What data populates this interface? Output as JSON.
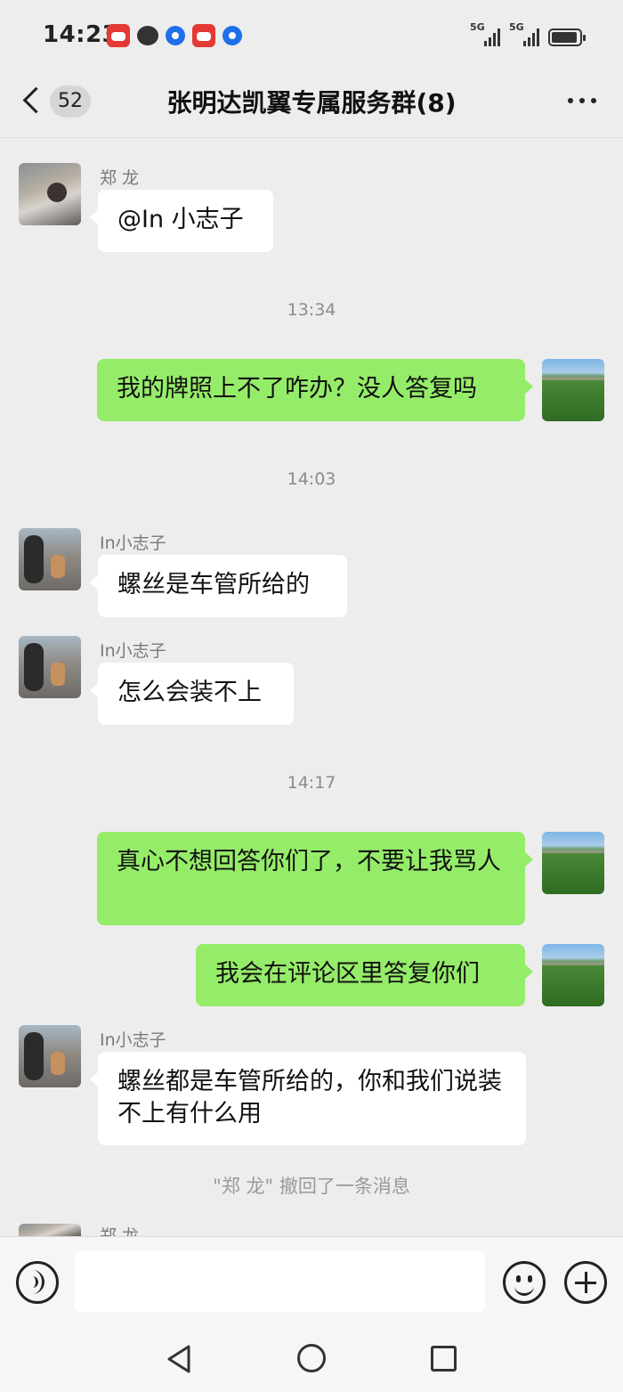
{
  "status_bar": {
    "time": "14:23",
    "network_1": "5G",
    "network_2": "5G",
    "notification_icons": [
      "red-envelope-app-icon",
      "chat-bubble-icon",
      "blue-ring-app-icon",
      "red-envelope-app-icon",
      "blue-ring-app-icon"
    ]
  },
  "header": {
    "back_badge": "52",
    "title": "张明达凯翼专属服务群(8)"
  },
  "messages": [
    {
      "type": "in",
      "sender": "郑 龙",
      "text": "@In 小志子"
    },
    {
      "type": "time",
      "text": "13:34"
    },
    {
      "type": "out",
      "text": "我的牌照上不了咋办？没人答复吗"
    },
    {
      "type": "time",
      "text": "14:03"
    },
    {
      "type": "in",
      "sender": "In小志子",
      "text": "螺丝是车管所给的"
    },
    {
      "type": "in",
      "sender": "In小志子",
      "text": "怎么会装不上"
    },
    {
      "type": "time",
      "text": "14:17"
    },
    {
      "type": "out",
      "text": "真心不想回答你们了，不要让我骂人"
    },
    {
      "type": "out",
      "text": "我会在评论区里答复你们"
    },
    {
      "type": "in",
      "sender": "In小志子",
      "text": "螺丝都是车管所给的，你和我们说装不上有什么用"
    },
    {
      "type": "system",
      "text": "\"郑 龙\" 撤回了一条消息"
    },
    {
      "type": "in",
      "sender": "郑 龙",
      "text": ""
    }
  ],
  "colors": {
    "background": "#ededed",
    "out_bubble": "#95ec69",
    "in_bubble": "#ffffff"
  }
}
